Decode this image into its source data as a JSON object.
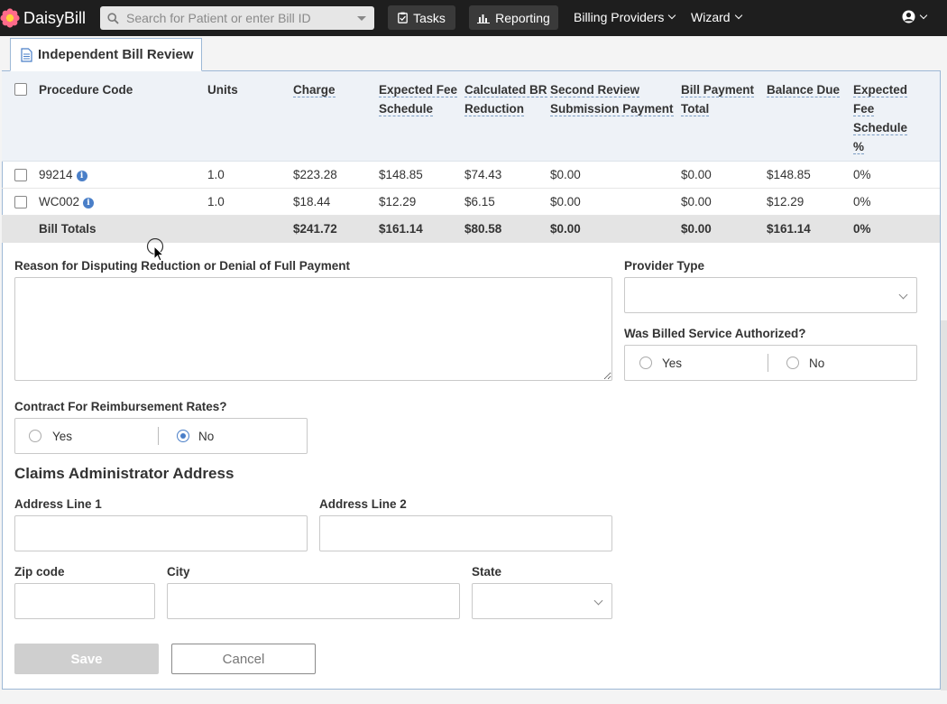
{
  "brand": {
    "name": "DaisyBill"
  },
  "nav": {
    "search_placeholder": "Search for Patient or enter Bill ID",
    "tasks": "Tasks",
    "reporting": "Reporting",
    "billing_providers": "Billing Providers",
    "wizard": "Wizard"
  },
  "tab": {
    "title": "Independent Bill Review"
  },
  "table": {
    "headers": {
      "procedure_code": "Procedure Code",
      "units": "Units",
      "charge": "Charge",
      "expected_fee_schedule": [
        "Expected Fee",
        "Schedule"
      ],
      "calculated_br_reduction": [
        "Calculated BR",
        "Reduction"
      ],
      "second_review": [
        "Second Review",
        "Submission Payment"
      ],
      "bill_payment_total": [
        "Bill Payment",
        "Total"
      ],
      "balance_due": "Balance Due",
      "expected_fee_schedule_pct": [
        "Expected",
        "Fee",
        "Schedule",
        "%"
      ]
    },
    "rows": [
      {
        "code": "99214",
        "units": "1.0",
        "charge": "$223.28",
        "expected": "$148.85",
        "br": "$74.43",
        "second": "$0.00",
        "payment": "$0.00",
        "balance": "$148.85",
        "pct": "0%"
      },
      {
        "code": "WC002",
        "units": "1.0",
        "charge": "$18.44",
        "expected": "$12.29",
        "br": "$6.15",
        "second": "$0.00",
        "payment": "$0.00",
        "balance": "$12.29",
        "pct": "0%"
      }
    ],
    "totals": {
      "label": "Bill Totals",
      "charge": "$241.72",
      "expected": "$161.14",
      "br": "$80.58",
      "second": "$0.00",
      "payment": "$0.00",
      "balance": "$161.14",
      "pct": "0%"
    }
  },
  "form": {
    "reason_label": "Reason for Disputing Reduction or Denial of Full Payment",
    "reason_value": "",
    "provider_type_label": "Provider Type",
    "provider_type_value": "",
    "authorized_label": "Was Billed Service Authorized?",
    "authorized_options": [
      "Yes",
      "No"
    ],
    "contract_label": "Contract For Reimbursement Rates?",
    "contract_options": [
      "Yes",
      "No"
    ],
    "contract_selected": "No",
    "address_title": "Claims Administrator Address",
    "address1_label": "Address Line 1",
    "address2_label": "Address Line 2",
    "zip_label": "Zip code",
    "city_label": "City",
    "state_label": "State",
    "save": "Save",
    "cancel": "Cancel"
  },
  "colors": {
    "accent": "#4a7fc8",
    "nav_bg": "#1e1e1e",
    "panel_border": "#9db8d6"
  }
}
